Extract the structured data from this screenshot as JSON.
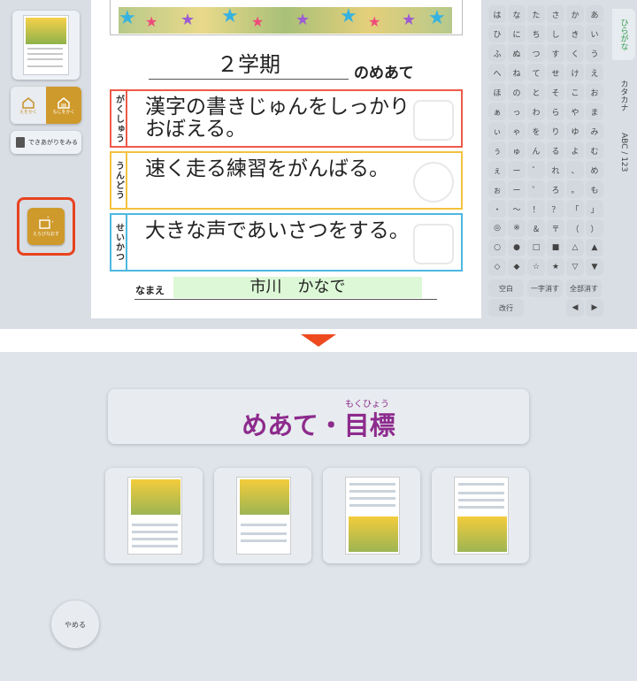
{
  "left_tools": {
    "text_mode_left": "えをかく",
    "text_mode_right": "もじをかく",
    "check_label": "できあがりをみる",
    "redo_label": "えらびなおす"
  },
  "sheet": {
    "term": "２学期",
    "suffix": "のめあて",
    "goals": [
      {
        "label": "がくしゅう",
        "text": "漢字の書きじゅんをしっかりおぼえる。"
      },
      {
        "label": "うんどう",
        "text": "速く走る練習をがんばる。"
      },
      {
        "label": "せいかつ",
        "text": "大きな声であいさつをする。"
      }
    ],
    "name_label": "なまえ",
    "name_value": "市川　かなで"
  },
  "keyboard": {
    "rows": [
      [
        "は",
        "な",
        "た",
        "さ",
        "か",
        "あ"
      ],
      [
        "ひ",
        "に",
        "ち",
        "し",
        "き",
        "い"
      ],
      [
        "ふ",
        "ぬ",
        "つ",
        "す",
        "く",
        "う"
      ],
      [
        "へ",
        "ね",
        "て",
        "せ",
        "け",
        "え"
      ],
      [
        "ほ",
        "の",
        "と",
        "そ",
        "こ",
        "お"
      ],
      [
        "ぁ",
        "っ",
        "わ",
        "ら",
        "や",
        "ま"
      ],
      [
        "ぃ",
        "ゃ",
        "を",
        "り",
        "ゆ",
        "み"
      ],
      [
        "ぅ",
        "ゅ",
        "ん",
        "る",
        "よ",
        "む"
      ],
      [
        "ぇ",
        "ー",
        "゛",
        "れ",
        "、",
        "め"
      ],
      [
        "ぉ",
        "ー",
        "゜",
        "ろ",
        "。",
        "も"
      ],
      [
        "・",
        "〜",
        "！",
        "？",
        "「",
        "」"
      ],
      [
        "◎",
        "※",
        "＆",
        "〒",
        "（",
        "）"
      ],
      [
        "○",
        "●",
        "□",
        "■",
        "△",
        "▲"
      ],
      [
        "◇",
        "◆",
        "☆",
        "★",
        "▽",
        "▼"
      ]
    ],
    "space_label": "空白",
    "delete_char_label": "一字消す",
    "delete_all_label": "全部消す",
    "newline_label": "改行"
  },
  "tabs": [
    "ひらがな",
    "カタカナ",
    "ABC / 123"
  ],
  "chooser": {
    "ruby": "もくひょう",
    "title": "めあて・目標",
    "quit_label": "やめる"
  }
}
